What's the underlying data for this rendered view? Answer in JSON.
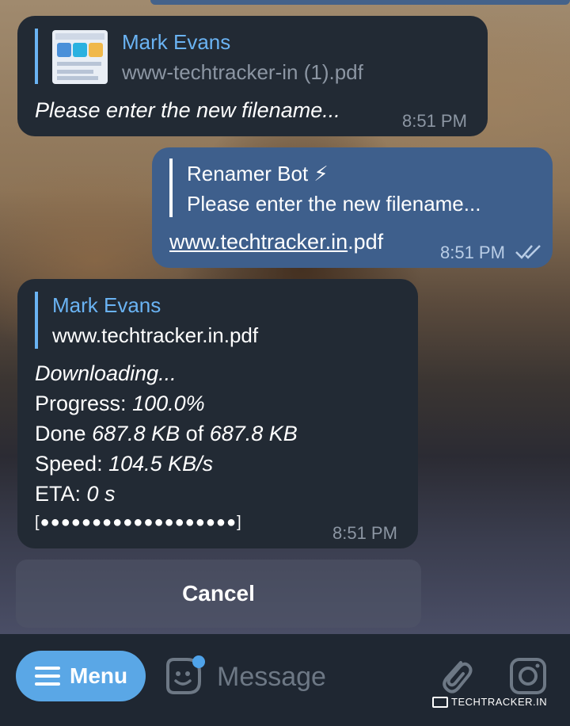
{
  "chat": {
    "messages": [
      {
        "direction": "incoming",
        "reply_name": "Mark Evans",
        "reply_sub": "www-techtracker-in (1).pdf",
        "text": "Please enter the new filename...",
        "time": "8:51 PM"
      },
      {
        "direction": "outgoing",
        "reply_name": "Renamer Bot ⚡",
        "reply_sub": "Please enter the new filename...",
        "text_link": "www.techtracker.in",
        "text_rest": ".pdf",
        "time": "8:51 PM",
        "status": "read"
      },
      {
        "direction": "incoming",
        "reply_name": "Mark Evans",
        "reply_sub": "www.techtracker.in.pdf",
        "heading": "Downloading...",
        "progress_label": "Progress:",
        "progress_value": "100.0%",
        "done_label": "Done",
        "done_value": "687.8 KB",
        "done_of": "of",
        "done_total": "687.8 KB",
        "speed_label": "Speed:",
        "speed_value": "104.5 KB/s",
        "eta_label": "ETA:",
        "eta_value": "0 s",
        "progress_bar": "[●●●●●●●●●●●●●●●●●●●]",
        "time": "8:51 PM"
      }
    ],
    "inline_button": "Cancel"
  },
  "input_bar": {
    "menu_label": "Menu",
    "placeholder": "Message"
  },
  "watermark": "TechTracker.in",
  "colors": {
    "incoming_bubble": "#222a34",
    "outgoing_bubble": "#3e5f8c",
    "accent": "#6ab3f3",
    "menu_button": "#5aa7e6"
  }
}
